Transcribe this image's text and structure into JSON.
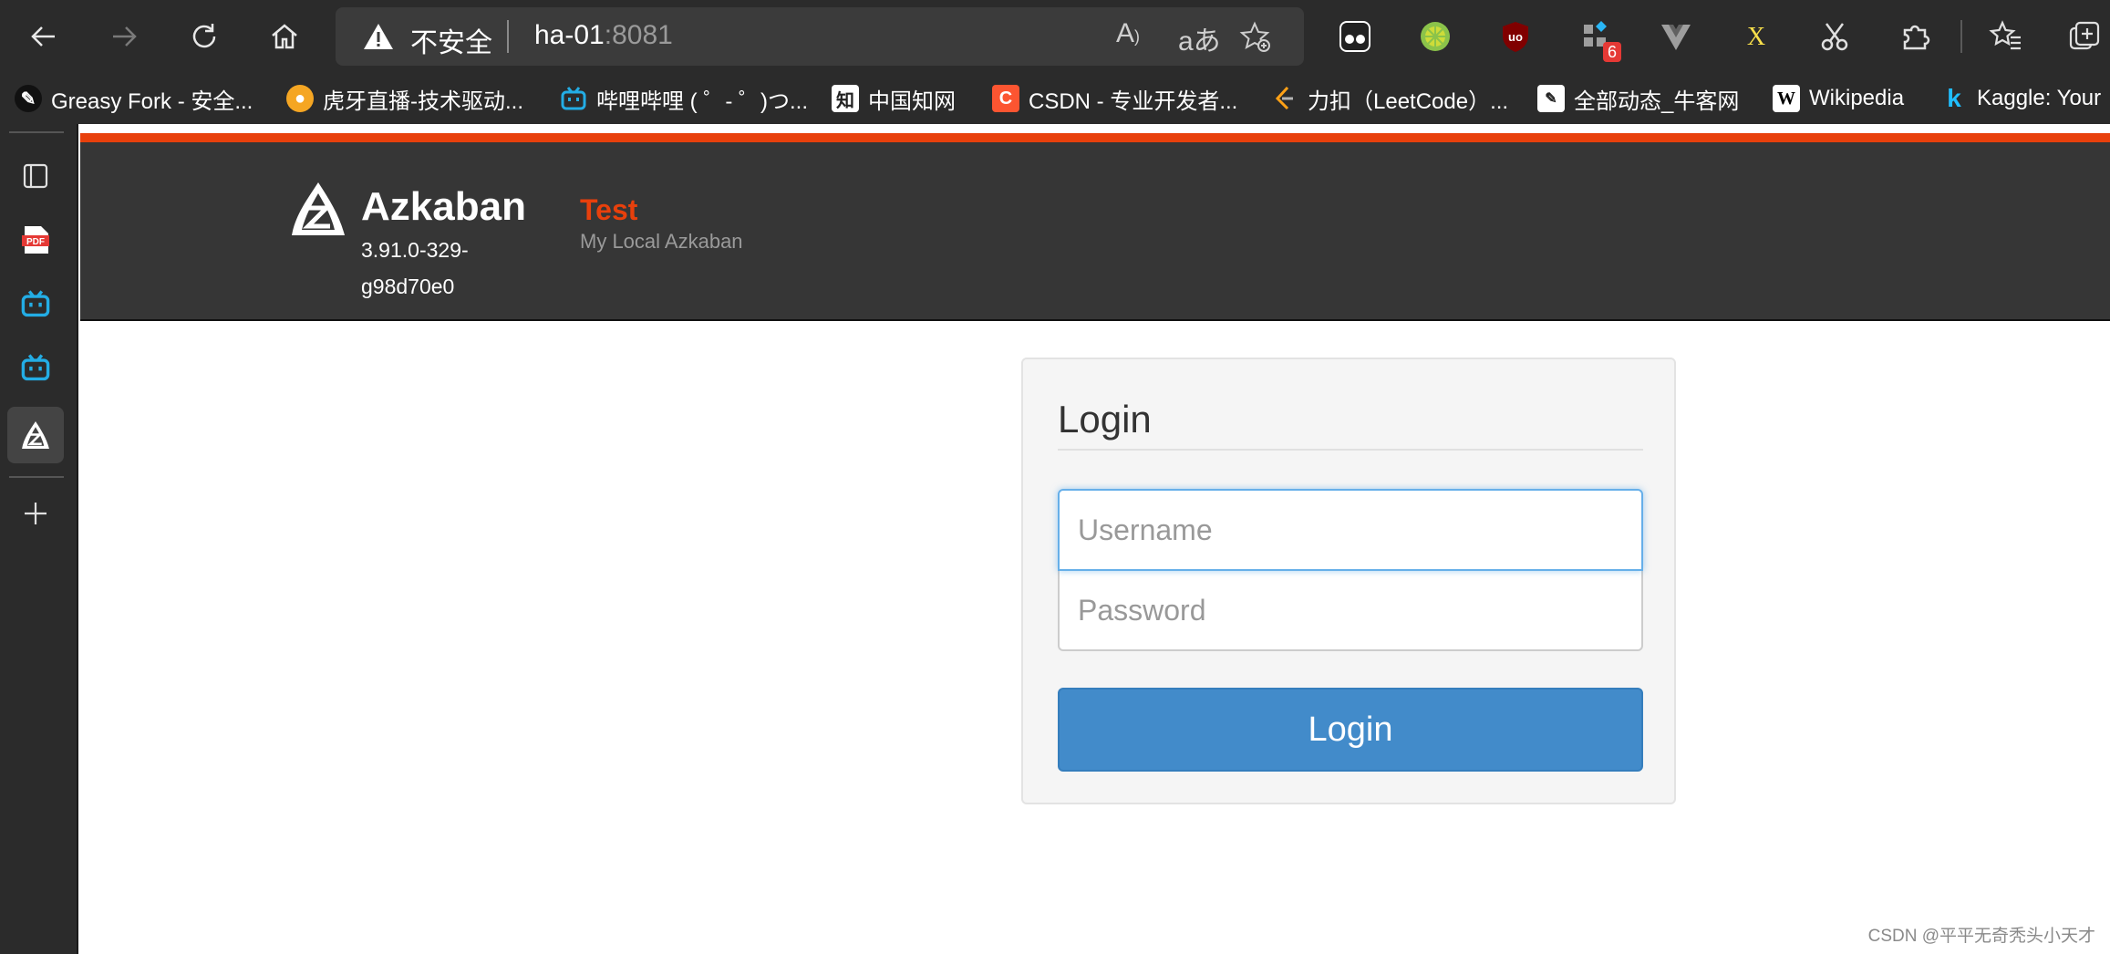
{
  "browser": {
    "address": {
      "security_label": "不安全",
      "host": "ha-01",
      "port": ":8081"
    },
    "extensions": [
      {
        "name": "tampermonkey-icon"
      },
      {
        "name": "lime-extension-icon"
      },
      {
        "name": "ublock-icon"
      },
      {
        "name": "extension-badge-icon",
        "badge": "6"
      },
      {
        "name": "vue-devtools-icon"
      },
      {
        "name": "xpath-helper-icon"
      },
      {
        "name": "scissors-icon"
      },
      {
        "name": "extensions-puzzle-icon"
      }
    ],
    "bookmarks": [
      {
        "label": "Greasy Fork - 安全...",
        "icon": "GF",
        "color": "#ffffff",
        "bg": "#111111"
      },
      {
        "label": "虎牙直播-技术驱动...",
        "icon": "虎",
        "color": "#ffffff",
        "bg": "#f5a623"
      },
      {
        "label": "哔哩哔哩 ( ゜- ゜)つ...",
        "icon": "TV",
        "color": "#ffffff",
        "bg": "#23ade5"
      },
      {
        "label": "中国知网",
        "icon": "知",
        "color": "#222222",
        "bg": "#ffffff"
      },
      {
        "label": "CSDN - 专业开发者...",
        "icon": "C",
        "color": "#ffffff",
        "bg": "#fc5531"
      },
      {
        "label": "力扣（LeetCode）...",
        "icon": "L",
        "color": "#ffa116",
        "bg": "#2b2b2b"
      },
      {
        "label": "全部动态_牛客网",
        "icon": "牛",
        "color": "#222222",
        "bg": "#ffffff"
      },
      {
        "label": "Wikipedia",
        "icon": "W",
        "color": "#000000",
        "bg": "#ffffff"
      },
      {
        "label": "Kaggle: Your",
        "icon": "k",
        "color": "#20beff",
        "bg": "#2b2b2b"
      }
    ]
  },
  "azkaban": {
    "brand": "Azkaban",
    "version": "3.91.0-329-g98d70e0",
    "env_name": "Test",
    "env_desc": "My Local Azkaban",
    "login": {
      "title": "Login",
      "username_placeholder": "Username",
      "password_placeholder": "Password",
      "button_label": "Login"
    },
    "accent_color": "#e8400c",
    "button_color": "#428bca"
  },
  "watermark": "CSDN @平平无奇秃头小天才"
}
